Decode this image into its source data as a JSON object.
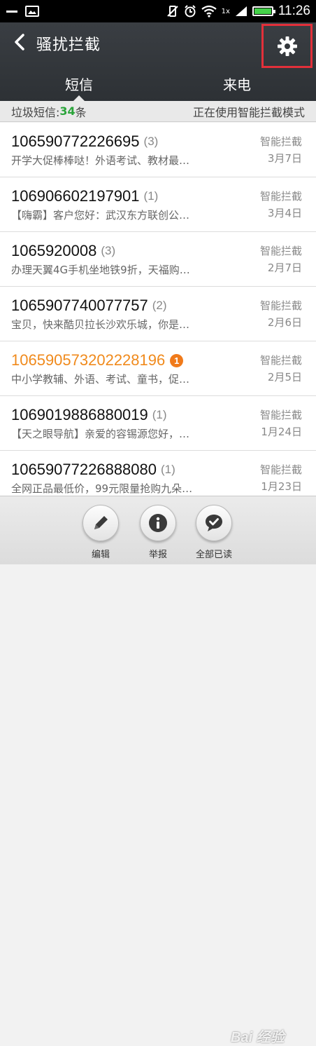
{
  "status_bar": {
    "time": "11:26",
    "network_label": "1x",
    "battery_level": 1.0,
    "battery_color": "#45d24a"
  },
  "header": {
    "title": "骚扰拦截",
    "settings_highlight_color": "#e2303a"
  },
  "tabs": [
    {
      "label": "短信",
      "active": true
    },
    {
      "label": "来电",
      "active": false
    }
  ],
  "summary": {
    "prefix": "垃圾短信:",
    "count": "34",
    "suffix": "条",
    "mode": "正在使用智能拦截模式"
  },
  "messages": [
    {
      "number": "106590772226695",
      "count": "(3)",
      "preview": "开学大促棒棒哒！外语考试、教材最…",
      "tag": "智能拦截",
      "date": "3月7日",
      "unread": ""
    },
    {
      "number": "106906602197901",
      "count": "(1)",
      "preview": "【嗨霸】客户您好：武汉东方联创公…",
      "tag": "智能拦截",
      "date": "3月4日",
      "unread": ""
    },
    {
      "number": "1065920008",
      "count": "(3)",
      "preview": "办理天翼4G手机坐地铁9折，天福购…",
      "tag": "智能拦截",
      "date": "2月7日",
      "unread": ""
    },
    {
      "number": "1065907740077757",
      "count": "(2)",
      "preview": "宝贝，快来酷贝拉长沙欢乐城，你是…",
      "tag": "智能拦截",
      "date": "2月6日",
      "unread": ""
    },
    {
      "number": "1065905732022281​96",
      "count": "",
      "preview": "中小学教辅、外语、考试、童书，促…",
      "tag": "智能拦截",
      "date": "2月5日",
      "unread": "1"
    },
    {
      "number": "1069019886880019",
      "count": "(1)",
      "preview": "【天之眼导航】亲爱的容锡源您好，…",
      "tag": "智能拦截",
      "date": "1月24日",
      "unread": ""
    },
    {
      "number": "10659077226888080",
      "count": "(1)",
      "preview": "全网正品最低价，99元限量抢购九朵…",
      "tag": "智能拦截",
      "date": "1月23日",
      "unread": ""
    }
  ],
  "actions": [
    {
      "label": "编辑",
      "icon": "pencil-icon"
    },
    {
      "label": "举报",
      "icon": "info-icon"
    },
    {
      "label": "全部已读",
      "icon": "check-bubble-icon"
    }
  ],
  "watermark": "Bai 经验"
}
